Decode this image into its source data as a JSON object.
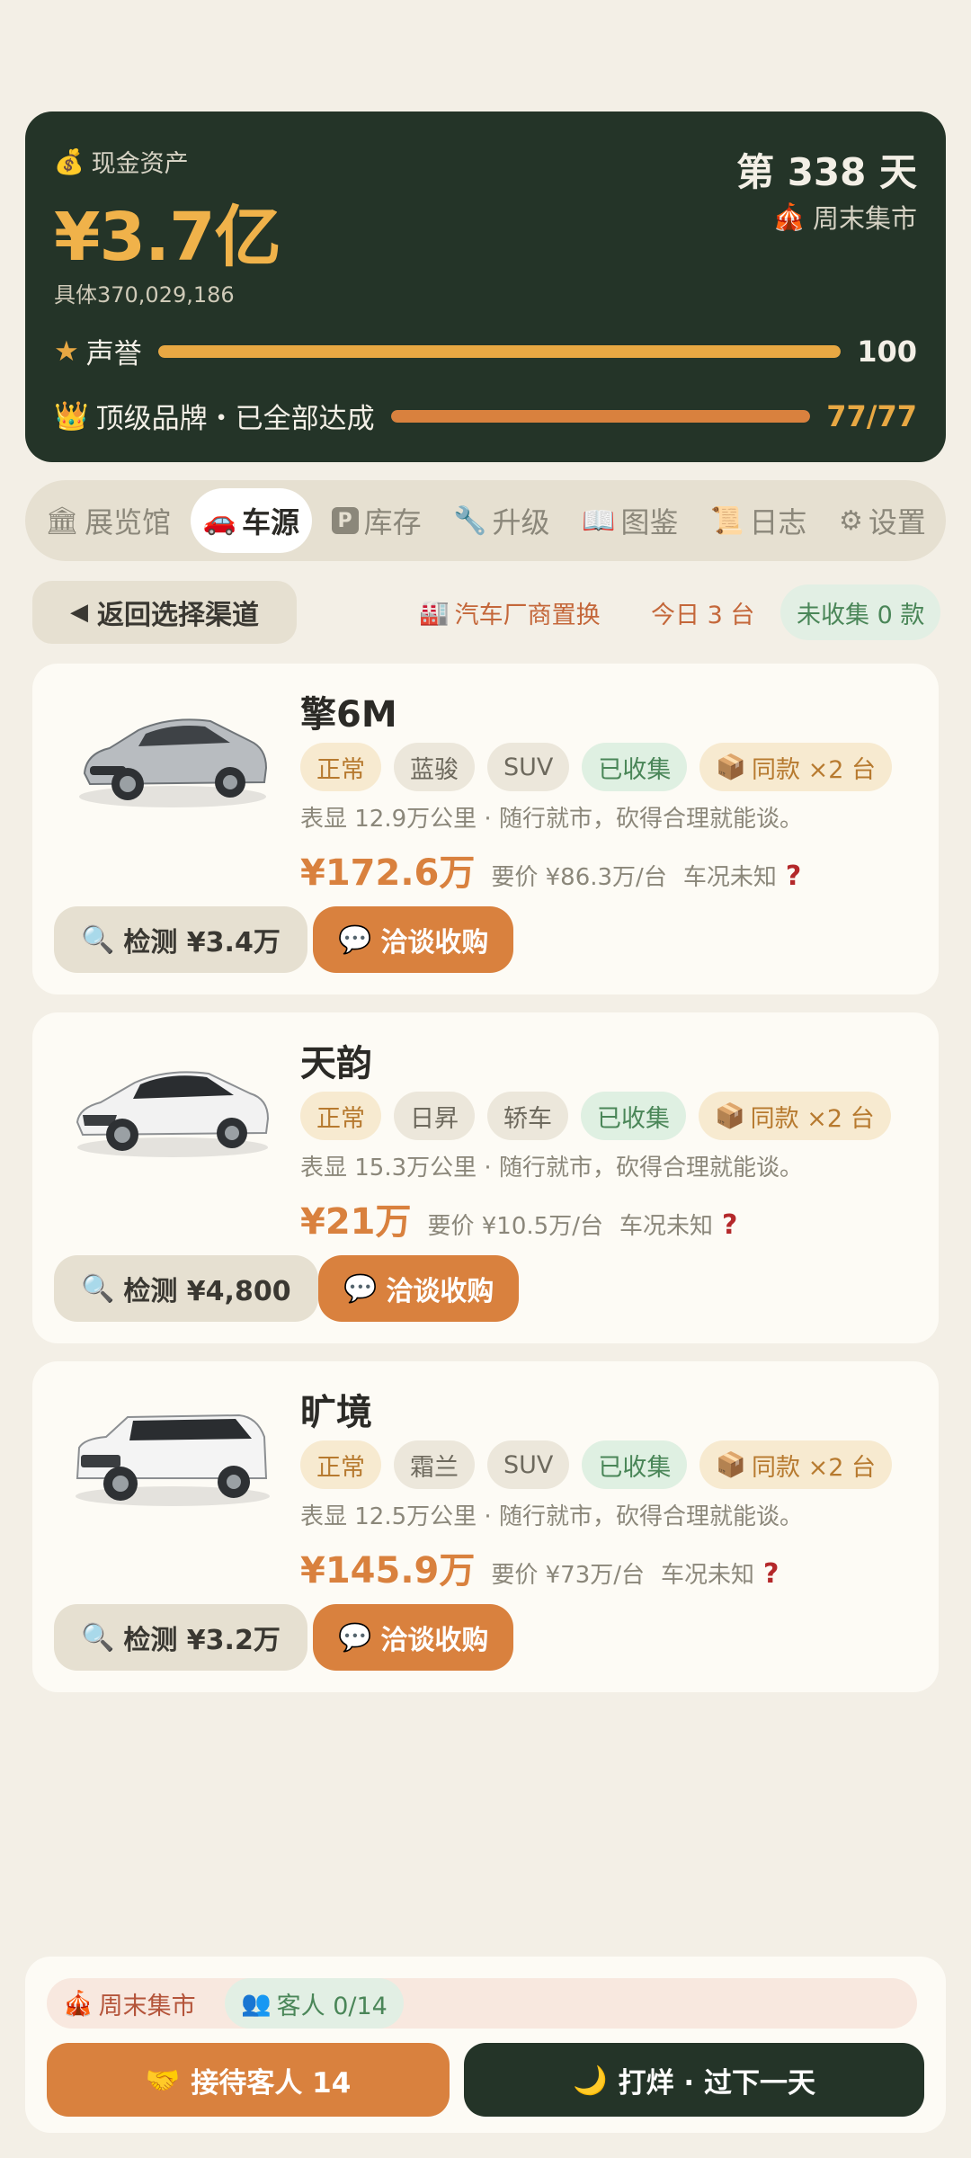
{
  "header": {
    "cash_label": "现金资产",
    "cash_value": "¥3.7亿",
    "cash_detail": "具体370,029,186",
    "day": "第 338 天",
    "market": "周末集市",
    "reputation": {
      "label": "声誉",
      "value": "100",
      "progress": 1.0
    },
    "brand": {
      "label": "顶级品牌・已全部达成",
      "value": "77/77",
      "progress": 1.0
    }
  },
  "tabs": [
    {
      "label": "展览馆",
      "icon": "museum-icon"
    },
    {
      "label": "车源",
      "icon": "car-icon",
      "active": true
    },
    {
      "label": "库存",
      "icon": "parking-icon"
    },
    {
      "label": "升级",
      "icon": "wrench-icon"
    },
    {
      "label": "图鉴",
      "icon": "book-icon"
    },
    {
      "label": "日志",
      "icon": "scroll-icon"
    },
    {
      "label": "设置",
      "icon": "gear-icon"
    }
  ],
  "subbar": {
    "back_label": "返回选择渠道",
    "channel": "汽车厂商置换",
    "today": "今日 3 台",
    "uncollected": "未收集 0 款"
  },
  "cars": [
    {
      "name": "擎6M",
      "condition": "正常",
      "brand": "蓝骏",
      "type": "SUV",
      "collected": "已收集",
      "same": "同款 ×2 台",
      "desc": "表显 12.9万公里 · 随行就市，砍得合理就能谈。",
      "price": "¥172.6万",
      "ask": "要价 ¥86.3万/台",
      "condition_status": "车况未知",
      "qmark": "?",
      "inspect": "检测 ¥3.4万",
      "negotiate": "洽谈收购",
      "body_color": "#b8bcc0"
    },
    {
      "name": "天韵",
      "condition": "正常",
      "brand": "日昇",
      "type": "轿车",
      "collected": "已收集",
      "same": "同款 ×2 台",
      "desc": "表显 15.3万公里 · 随行就市，砍得合理就能谈。",
      "price": "¥21万",
      "ask": "要价 ¥10.5万/台",
      "condition_status": "车况未知",
      "qmark": "?",
      "inspect": "检测 ¥4,800",
      "negotiate": "洽谈收购",
      "body_color": "#f2f2f2"
    },
    {
      "name": "旷境",
      "condition": "正常",
      "brand": "霜兰",
      "type": "SUV",
      "collected": "已收集",
      "same": "同款 ×2 台",
      "desc": "表显 12.5万公里 · 随行就市，砍得合理就能谈。",
      "price": "¥145.9万",
      "ask": "要价 ¥73万/台",
      "condition_status": "车况未知",
      "qmark": "?",
      "inspect": "检测 ¥3.2万",
      "negotiate": "洽谈收购",
      "body_color": "#f4f4f4"
    }
  ],
  "footer": {
    "market_chip": "周末集市",
    "guests_chip": "客人 0/14",
    "receive_label": "接待客人 14",
    "close_label": "打烊 · 过下一天"
  }
}
